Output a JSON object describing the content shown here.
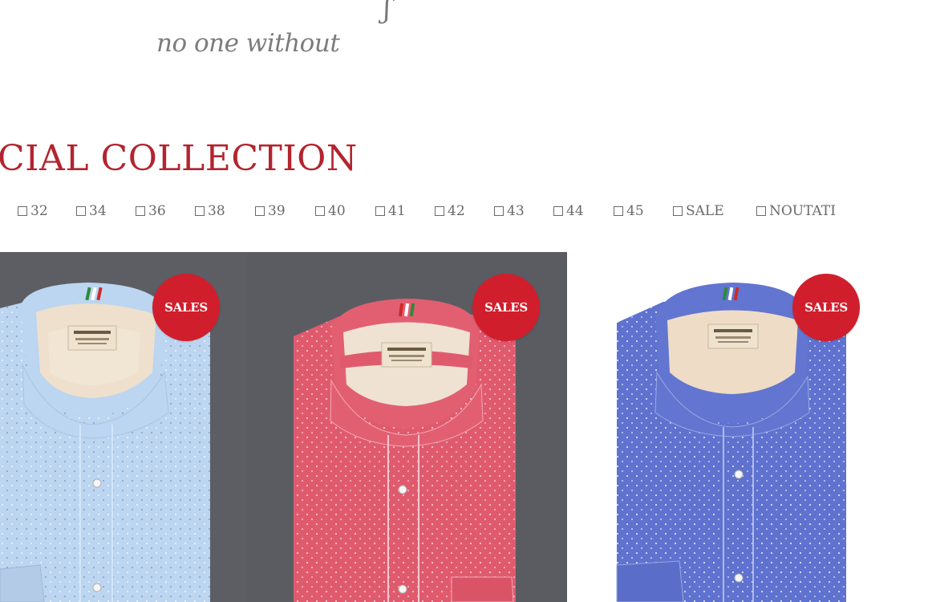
{
  "hero": {
    "tagline": "no one without"
  },
  "collection": {
    "title": "CIAL COLLECTION"
  },
  "filters": [
    {
      "label": "32"
    },
    {
      "label": "34"
    },
    {
      "label": "36"
    },
    {
      "label": "38"
    },
    {
      "label": "39"
    },
    {
      "label": "40"
    },
    {
      "label": "41"
    },
    {
      "label": "42"
    },
    {
      "label": "43"
    },
    {
      "label": "44"
    },
    {
      "label": "45"
    },
    {
      "label": "SALE"
    },
    {
      "label": "NOUTATI"
    }
  ],
  "products": [
    {
      "badge": "SALES",
      "shirt_color": "#bcd5f0",
      "background": "#5c5e64",
      "label_brand": "FIL NOIR"
    },
    {
      "badge": "SALES",
      "shirt_color": "#e05a6e",
      "background": "#5a5c62",
      "label_brand": "FIL NOIR"
    },
    {
      "badge": "SALES",
      "shirt_color": "#5f72cf",
      "background": "#ffffff",
      "label_brand": "FIL NOIR"
    }
  ],
  "colors": {
    "accent": "#b3242f",
    "badge": "#d11e2c",
    "text_muted": "#6a6a6a"
  }
}
